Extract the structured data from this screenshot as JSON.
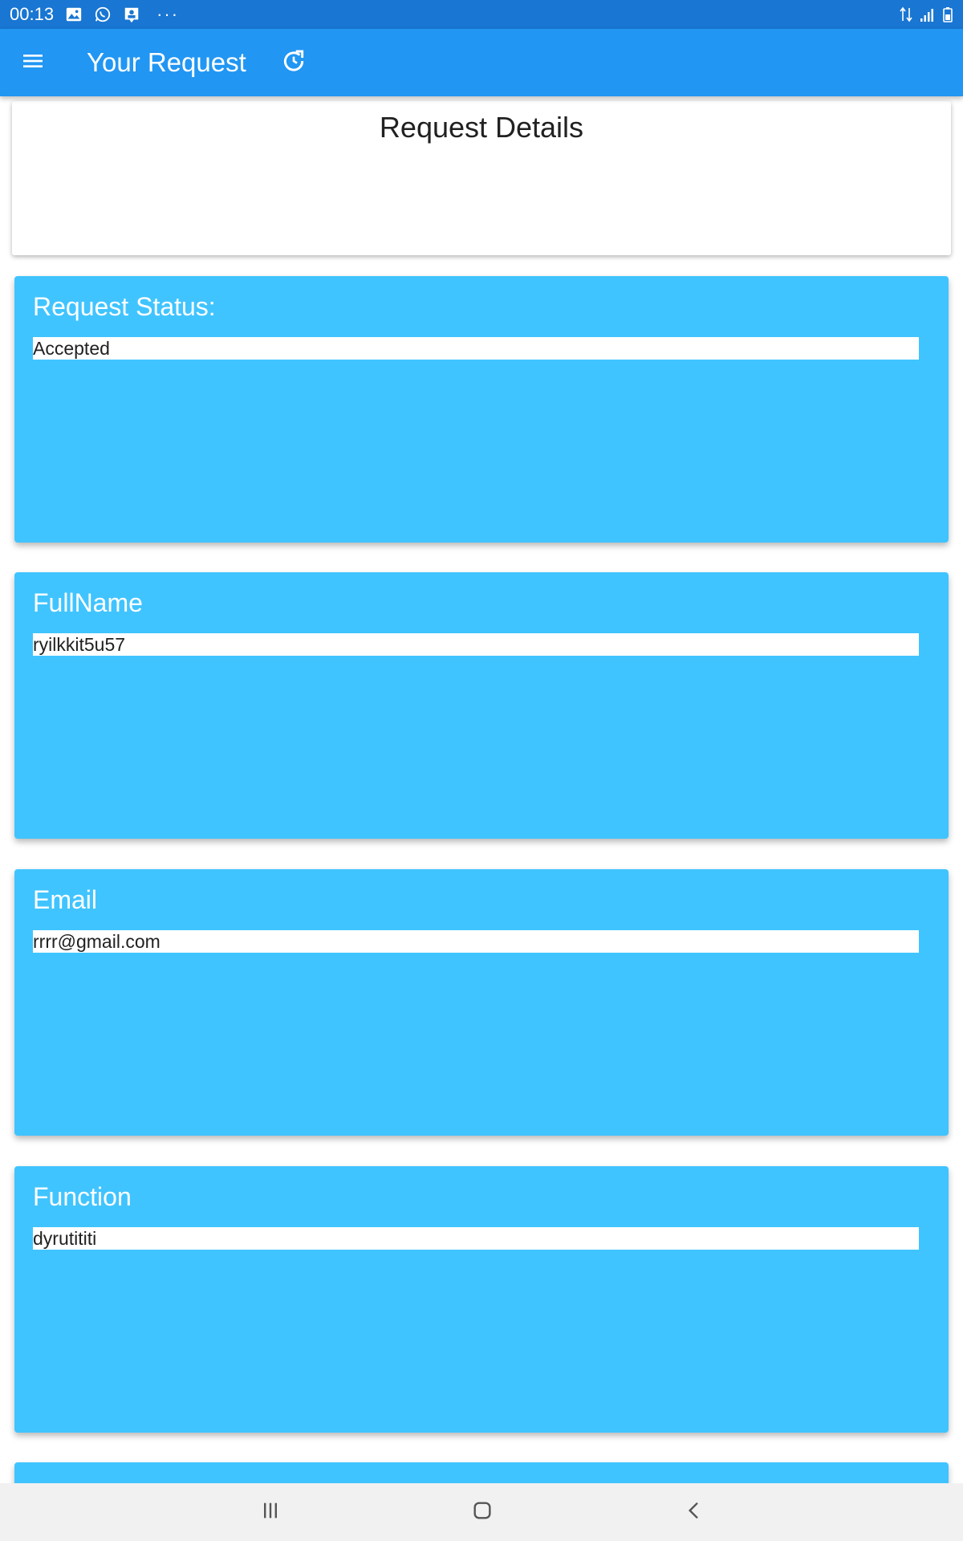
{
  "status_bar": {
    "time": "00:13",
    "overflow": "···",
    "icons": [
      "image-icon",
      "whatsapp-icon",
      "contact-card-icon"
    ],
    "right_icons": [
      "data-transfer-icon",
      "signal-icon",
      "battery-icon"
    ]
  },
  "app_bar": {
    "title": "Your Request",
    "menu_icon": "menu-icon",
    "refresh_icon": "refresh-icon",
    "color": "#2196F3"
  },
  "header_card": {
    "title": "Request Details"
  },
  "cards": [
    {
      "label": "Request Status:",
      "value": "Accepted"
    },
    {
      "label": "FullName",
      "value": "ryilkkit5u57"
    },
    {
      "label": "Email",
      "value": "rrrr@gmail.com"
    },
    {
      "label": "Function",
      "value": "dyrutititi"
    }
  ],
  "card_color": "#40C4FF",
  "nav_bar": {
    "icons": [
      "recent-apps-icon",
      "home-icon",
      "back-icon"
    ]
  }
}
